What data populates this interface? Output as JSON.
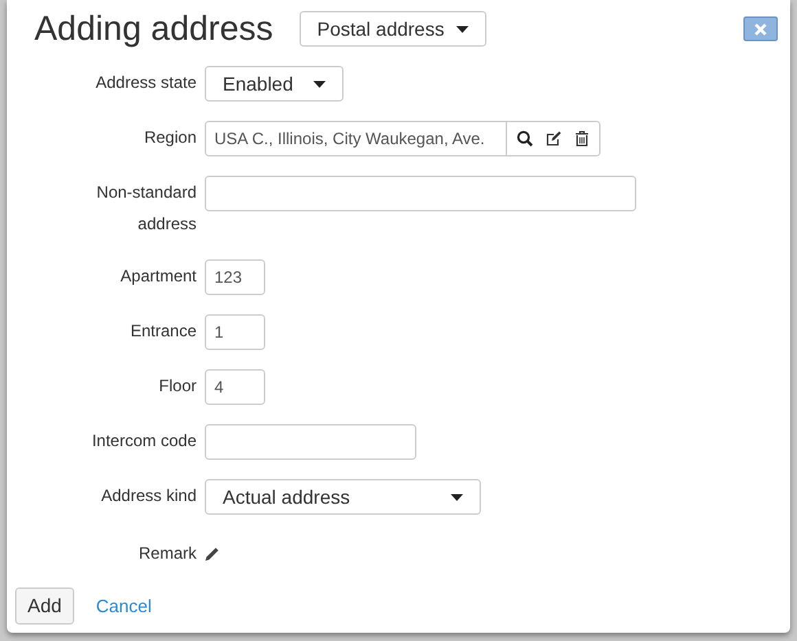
{
  "dialog": {
    "title": "Adding address",
    "type_select": {
      "value": "Postal address"
    }
  },
  "fields": [
    {
      "kind": "select",
      "label": "Address state",
      "value": "Enabled"
    },
    {
      "kind": "region",
      "label": "Region",
      "value": "USA C., Illinois, City Waukegan, Ave."
    },
    {
      "kind": "text",
      "label": "Non-standard address"
    },
    {
      "kind": "text",
      "label": "Apartment",
      "value": "123"
    },
    {
      "kind": "text",
      "label": "Entrance",
      "value": "1"
    },
    {
      "kind": "text",
      "label": "Floor",
      "value": "4"
    },
    {
      "kind": "text",
      "label": "Intercom code"
    },
    {
      "kind": "select",
      "label": "Address kind",
      "value": "Actual address"
    },
    {
      "kind": "remark",
      "label": "Remark"
    }
  ],
  "buttons": {
    "primary": "Add",
    "link": "Cancel"
  }
}
